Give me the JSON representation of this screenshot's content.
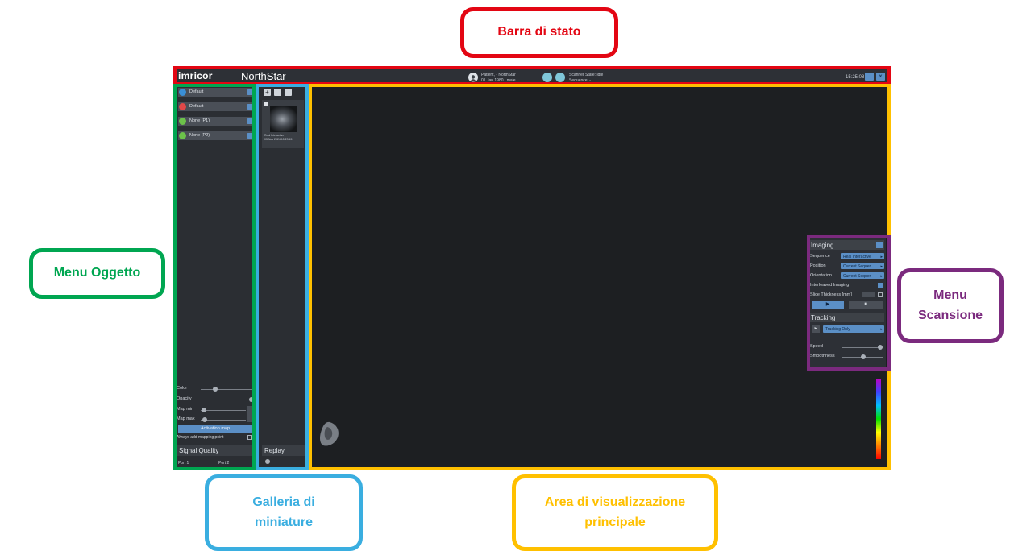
{
  "callouts": {
    "status_bar": "Barra di stato",
    "object_menu": "Menu Oggetto",
    "scan_menu_line1": "Menu",
    "scan_menu_line2": "Scansione",
    "thumbnails_line1": "Galleria di",
    "thumbnails_line2": "miniature",
    "main_view_line1": "Area di visualizzazione",
    "main_view_line2": "principale"
  },
  "colors": {
    "status_bar": "#e30613",
    "object_menu": "#00a651",
    "scan_menu": "#7b2a7e",
    "thumbnails": "#3aaee0",
    "main_view": "#ffc000"
  },
  "topbar": {
    "logo": "imricor",
    "app_name": "NorthStar",
    "patient_line1": "Patient, - NorthStar",
    "patient_line2": "01 Jan 1980 , male",
    "scanner_state": "Scanner State: idle",
    "sequence": "Sequence: -",
    "clock": "15:25:08",
    "icons": [
      "patient-icon",
      "scanner-icon",
      "monitor-icon",
      "close-icon"
    ]
  },
  "object_menu": {
    "items": [
      {
        "label": "Default",
        "color": "#3a8fd6"
      },
      {
        "label": "Default",
        "color": "#e04848"
      },
      {
        "label": "None (P1)",
        "color": "#6cc24a"
      },
      {
        "label": "None (P2)",
        "color": "#6cc24a"
      }
    ],
    "controls": {
      "color_label": "Color",
      "opacity_label": "Opacity",
      "map_min_label": "Map min",
      "map_max_label": "Map max",
      "activation_map_button": "Activation map",
      "always_add_label": "Always add mapping point"
    },
    "signal_quality": {
      "title": "Signal Quality",
      "port1": "Port 1",
      "port2": "Port 2"
    }
  },
  "thumbnails": {
    "item_caption1": "Real Interactive",
    "item_caption2": "05 Nov 2024 15:23:45",
    "replay_label": "Replay"
  },
  "scan_menu": {
    "imaging_title": "Imaging",
    "sequence_label": "Sequence",
    "sequence_value": "Real Interactive",
    "position_label": "Position",
    "position_value": "Current Sequen",
    "orientation_label": "Orientation",
    "orientation_value": "Current Sequen",
    "interleaved_label": "Interleaved Imaging",
    "slice_label": "Slice Thickness [mm]",
    "tracking_title": "Tracking",
    "tracking_value": "Tracking Only",
    "speed_label": "Speed",
    "smoothness_label": "Smoothness"
  }
}
